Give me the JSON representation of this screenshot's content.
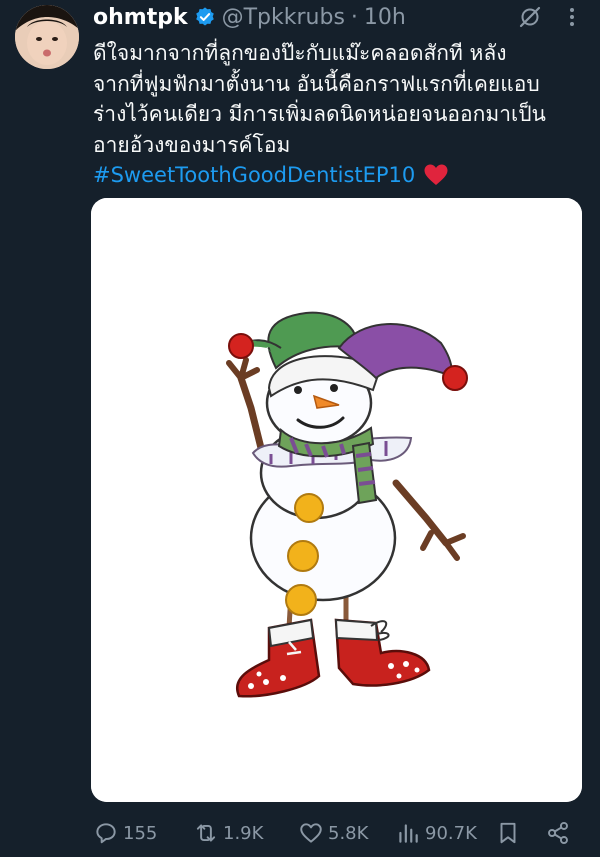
{
  "tweet": {
    "display_name": "ohmtpk",
    "handle": "@Tpkkrubs",
    "separator": "·",
    "time": "10h",
    "body_lines": [
      "ดีใจมากจากที่ลูกของป๊ะกับแม๊ะคลอดสักที หลัง",
      "จากที่ฟูมฟักมาตั้งนาน อันนี้คือกราฟแรกที่เคยแอบ",
      "ร่างไว้คนเดียว มีการเพิ่มลดนิดหน่อยจนออกมาเป็น",
      "อายอ้วงของมารค์โอม"
    ],
    "hashtag": "#SweetToothGoodDentistEP10"
  },
  "actions": {
    "replies": "155",
    "reposts": "1.9K",
    "likes": "5.8K",
    "views": "90.7K"
  },
  "colors": {
    "background": "#15202b",
    "accent": "#1d9bf0",
    "muted": "#8b98a5",
    "heart": "#f91880"
  },
  "icons": [
    "verified-badge-icon",
    "grok-icon",
    "more-icon",
    "heart-emoji-icon",
    "reply-icon",
    "repost-icon",
    "like-icon",
    "views-icon",
    "bookmark-icon",
    "share-icon"
  ]
}
